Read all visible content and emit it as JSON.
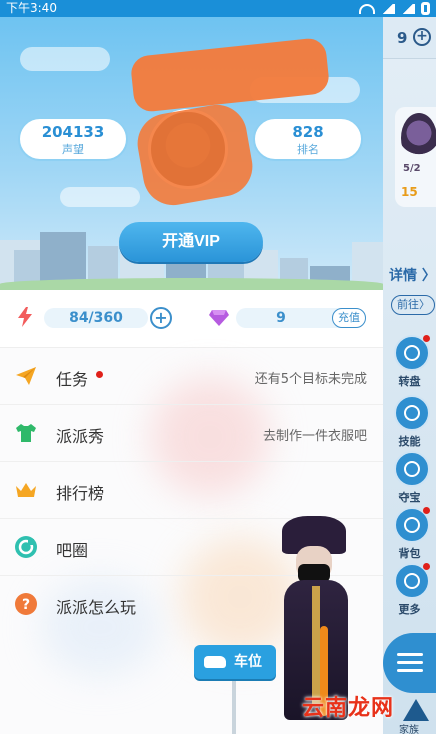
{
  "status_bar": {
    "time": "下午3:40"
  },
  "profile": {
    "reputation_value": "204133",
    "reputation_label": "声望",
    "rank_value": "828",
    "rank_label": "排名",
    "vip_button": "开通VIP"
  },
  "resources": {
    "energy": "84/360",
    "gems": "9",
    "recharge_label": "充值"
  },
  "menu": [
    {
      "title": "任务",
      "status": "还有5个目标未完成",
      "icon": "paper-plane-icon",
      "color": "#f5a623",
      "has_dot": true
    },
    {
      "title": "派派秀",
      "status": "去制作一件衣服吧",
      "icon": "tshirt-icon",
      "color": "#2fb96a"
    },
    {
      "title": "排行榜",
      "status": "",
      "icon": "crown-icon",
      "color": "#f5a623"
    },
    {
      "title": "吧圈",
      "status": "",
      "icon": "circle-refresh-icon",
      "color": "#2fc0b0"
    },
    {
      "title": "派派怎么玩",
      "status": "",
      "icon": "question-icon",
      "color": "#f07a3a"
    }
  ],
  "right_panel": {
    "count": "9",
    "avatar_score": "5/2",
    "coin": "15",
    "details": "详情 〉",
    "goto": "前往〉",
    "buttons": [
      {
        "label": "转盘",
        "icon": "wheel-icon"
      },
      {
        "label": "技能",
        "icon": "star-icon"
      },
      {
        "label": "夺宝",
        "icon": "gem-icon"
      },
      {
        "label": "背包",
        "icon": "bag-icon"
      },
      {
        "label": "更多",
        "icon": "more-icon"
      }
    ],
    "family_label": "家族"
  },
  "parking": {
    "label": "车位"
  },
  "watermark": "云南龙网",
  "colors": {
    "accent": "#2a94d8",
    "scribble": "#f47a3a"
  }
}
